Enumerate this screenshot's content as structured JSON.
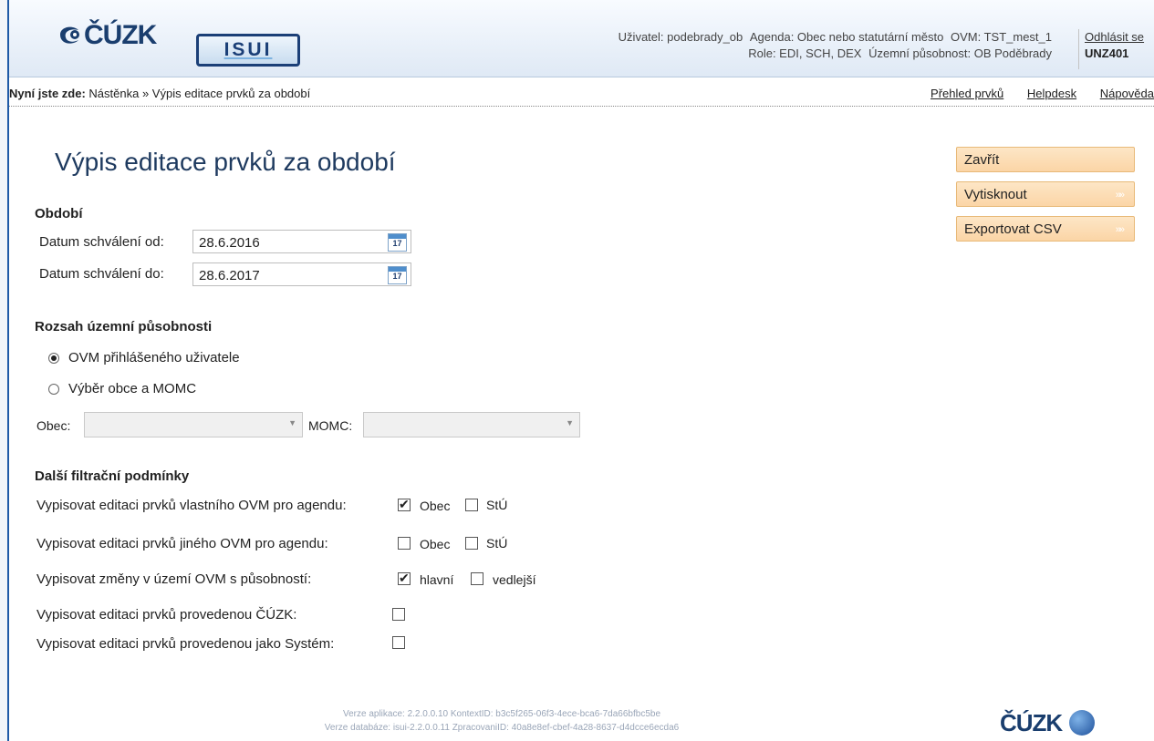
{
  "header": {
    "logo_text": "ČÚZK",
    "app_badge": "ISUI",
    "user_line1": [
      "Uživatel: podebrady_ob",
      "Agenda: Obec nebo statutární město",
      "OVM: TST_mest_1"
    ],
    "user_line2": [
      "Role: EDI, SCH, DEX",
      "Územní působnost: OB Poděbrady"
    ],
    "logout": "Odhlásit se",
    "code": "UNZ401"
  },
  "breadcrumb": {
    "prefix": "Nyní jste zde:",
    "path": "Nástěnka » Výpis editace prvků za období",
    "links": [
      "Přehled prvků",
      "Helpdesk",
      "Nápověda"
    ]
  },
  "page": {
    "title": "Výpis editace prvků za období"
  },
  "actions": {
    "close": "Zavřít",
    "print": "Vytisknout",
    "export": "Exportovat CSV",
    "arrow": "»»"
  },
  "period": {
    "heading": "Období",
    "from_label": "Datum schválení od:",
    "from_value": "28.6.2016",
    "to_label": "Datum schválení do:",
    "to_value": "28.6.2017",
    "cal_icon_text": "17"
  },
  "scope": {
    "heading": "Rozsah územní působnosti",
    "option1": "OVM přihlášeného uživatele",
    "option2": "Výběr obce a MOMC",
    "selected": "option1",
    "obec_label": "Obec:",
    "momc_label": "MOMC:"
  },
  "filters": {
    "heading": "Další filtrační podmínky",
    "row1": {
      "label": "Vypisovat editaci prvků vlastního OVM pro agendu:",
      "a": "Obec",
      "a_checked": true,
      "b": "StÚ",
      "b_checked": false
    },
    "row2": {
      "label": "Vypisovat editaci prvků jiného OVM pro agendu:",
      "a": "Obec",
      "a_checked": false,
      "b": "StÚ",
      "b_checked": false
    },
    "row3": {
      "label": "Vypisovat změny v území OVM s působností:",
      "a": "hlavní",
      "a_checked": true,
      "b": "vedlejší",
      "b_checked": false
    },
    "row4": {
      "label": "Vypisovat editaci prvků provedenou ČÚZK:",
      "checked": false
    },
    "row5": {
      "label": "Vypisovat editaci prvků provedenou jako Systém:",
      "checked": false
    }
  },
  "footer": {
    "line1": "Verze aplikace: 2.2.0.0.10 KontextID: b3c5f265-06f3-4ece-bca6-7da66bfbc5be",
    "line2": "Verze databáze: isui-2.2.0.0.11 ZpracovaniID: 40a8e8ef-cbef-4a28-8637-d4dcce6ecda6",
    "logo_text": "ČÚZK"
  }
}
